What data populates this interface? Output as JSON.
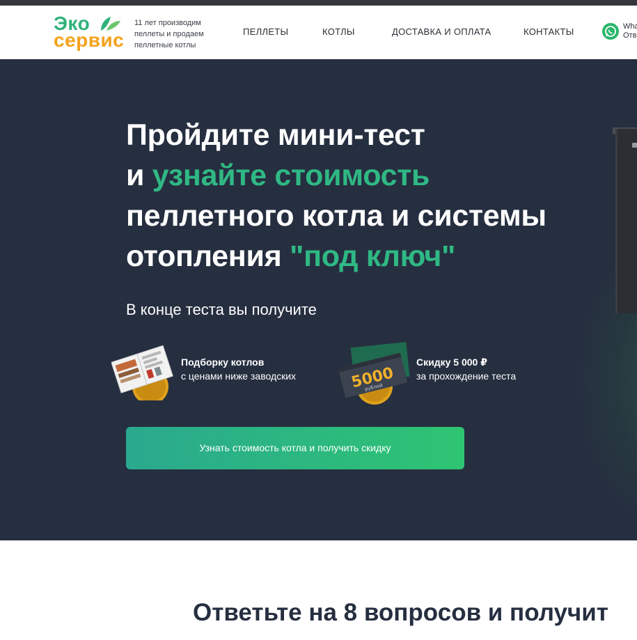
{
  "header": {
    "logo_line1": "Эко",
    "logo_line2": "сервис",
    "tagline": "11 лет производим пеллеты и продаем пеллетные котлы",
    "nav": [
      "ПЕЛЛЕТЫ",
      "КОТЛЫ",
      "ДОСТАВКА И ОПЛАТА",
      "КОНТАКТЫ"
    ],
    "whatsapp_line1": "Wha",
    "whatsapp_line2": "Отв"
  },
  "hero": {
    "headline_line1": "Пройдите мини-тест",
    "headline_line2_prefix": "и ",
    "headline_line2_highlight": "узнайте стоимость",
    "headline_line3": "пеллетного котла и системы",
    "headline_line4_prefix": "отопления ",
    "headline_line4_highlight": "\"под ключ\"",
    "subhead": "В конце теста вы получите",
    "benefits": [
      {
        "title": "Подборку котлов",
        "text": "с ценами ниже заводских",
        "icon": "catalog-icon"
      },
      {
        "title": "Скидку 5 000 ₽",
        "text": "за прохождение теста",
        "icon": "discount-certificate-icon",
        "badge_value": "5000",
        "badge_unit": "рублей"
      }
    ],
    "cta_label": "Узнать стоимость котла и получить скидку"
  },
  "section": {
    "title": "Ответьте на 8 вопросов и получит"
  },
  "colors": {
    "accent_green": "#2fb883",
    "brand_orange": "#f4a21c",
    "hero_bg": "#262f40"
  }
}
